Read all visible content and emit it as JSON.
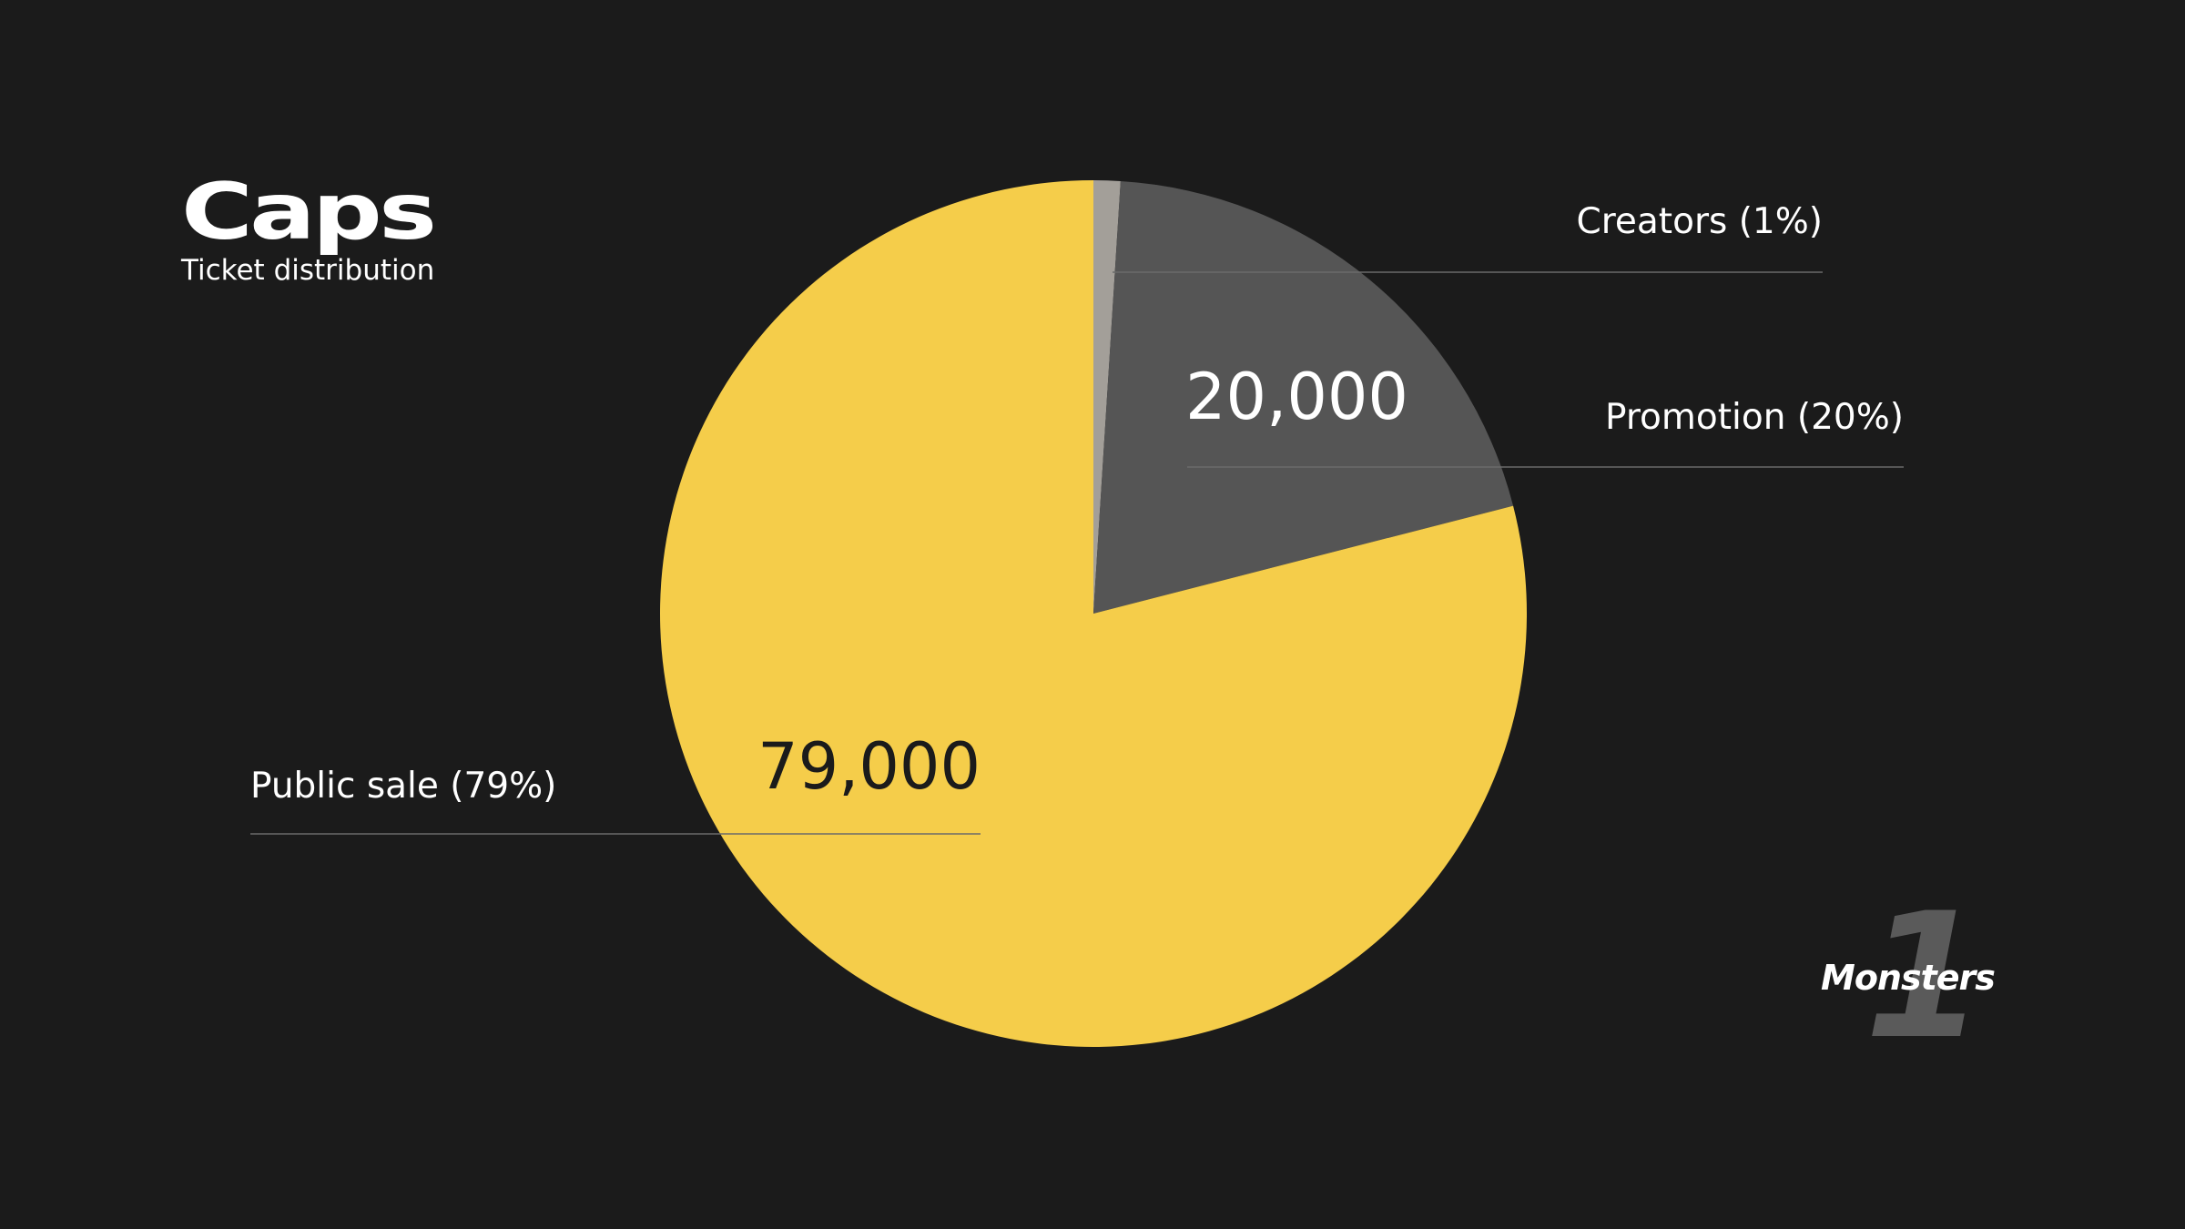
{
  "brand": {
    "logo_text": "Caps",
    "subtitle": "Ticket distribution"
  },
  "corner": {
    "glyph": "1",
    "text": "Monsters"
  },
  "colors": {
    "background": "#1b1b1b",
    "public_sale": "#f5cd4a",
    "promotion": "#555555",
    "creators": "#a39f99",
    "text": "#ffffff",
    "dark_text": "#1b1b1b",
    "leader_line": "#6b6b6b"
  },
  "chart_data": {
    "type": "pie",
    "start_angle_deg": 0,
    "direction": "clockwise",
    "slices": [
      {
        "label": "Creators (1%)",
        "value": 1000,
        "percent": 1,
        "color": "#a39f99",
        "value_label": ""
      },
      {
        "label": "Promotion (20%)",
        "value": 20000,
        "percent": 20,
        "color": "#555555",
        "value_label": "20,000"
      },
      {
        "label": "Public sale (79%)",
        "value": 79000,
        "percent": 79,
        "color": "#f5cd4a",
        "value_label": "79,000"
      }
    ]
  }
}
